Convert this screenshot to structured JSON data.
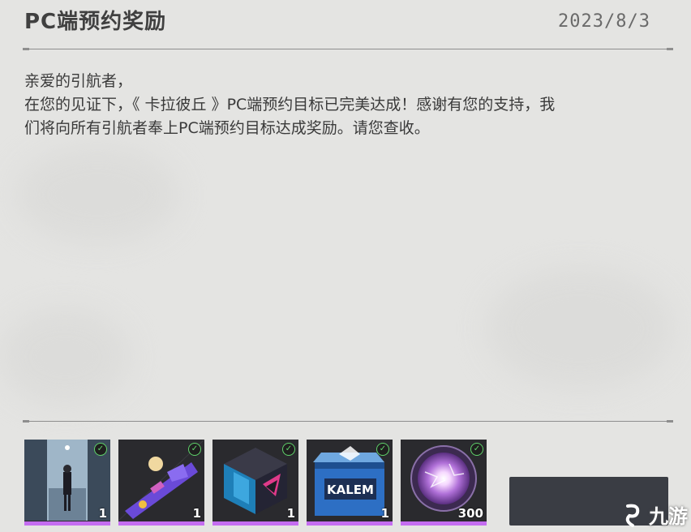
{
  "mail": {
    "title": "PC端预约奖励",
    "date": "2023/8/3",
    "greeting": "亲爱的引航者，",
    "body_line1": "在您的见证下，《 卡拉彼丘 》PC端预约目标已完美达成！感谢有您的支持，我",
    "body_line2": "们将向所有引航者奉上PC端预约目标达成奖励。请您查收。"
  },
  "rewards": [
    {
      "icon": "character-poster-icon",
      "quantity": "1",
      "claimed": true
    },
    {
      "icon": "weapon-skin-icon",
      "quantity": "1",
      "claimed": true
    },
    {
      "icon": "cube-icon",
      "quantity": "1",
      "claimed": true
    },
    {
      "icon": "kalem-crate-icon",
      "quantity": "1",
      "claimed": true,
      "label": "KALEM"
    },
    {
      "icon": "energy-orb-icon",
      "quantity": "300",
      "claimed": true
    }
  ],
  "colors": {
    "accent_bar": "#c46df0",
    "claimed_check": "#5fd36a",
    "button": "#3a3d44"
  },
  "watermark": {
    "text": "九游"
  }
}
